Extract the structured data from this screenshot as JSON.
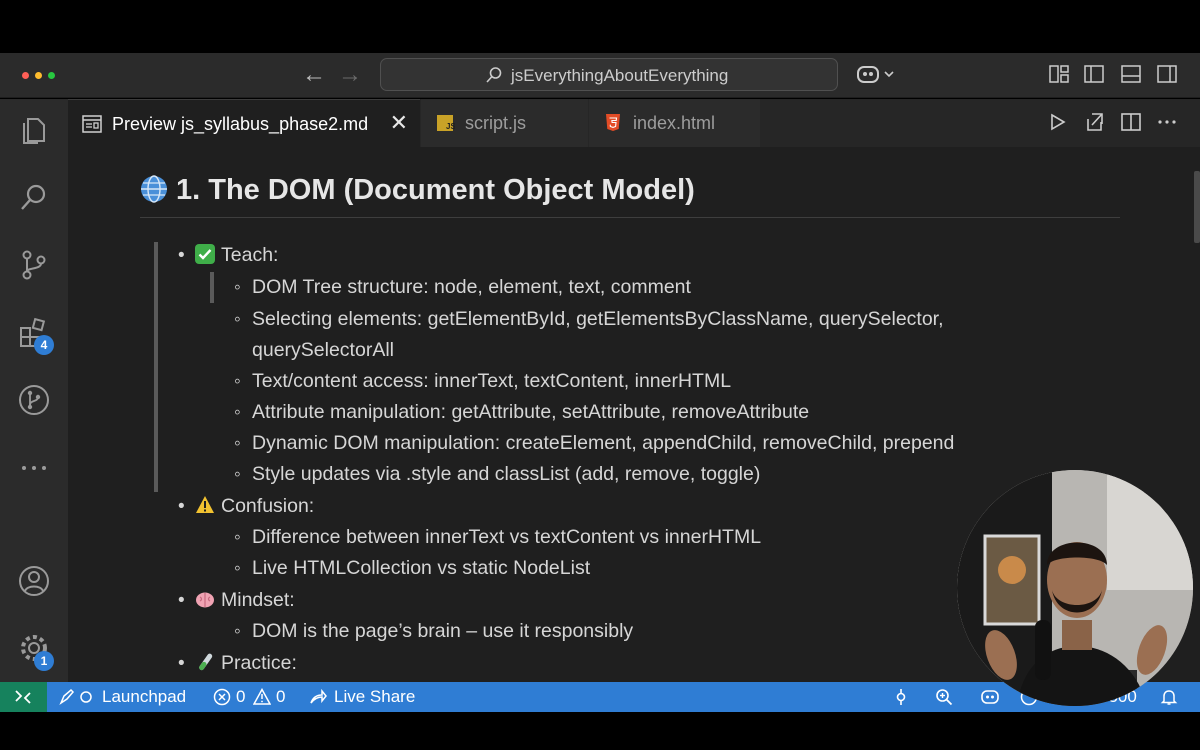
{
  "window": {
    "command_center": "jsEverythingAboutEverything",
    "traffic_colors": [
      "#ff5f57",
      "#febc2e",
      "#28c840"
    ]
  },
  "tabs": [
    {
      "label": "Preview js_syllabus_phase2.md",
      "active": true,
      "icon": "preview-icon",
      "close": "✕"
    },
    {
      "label": "script.js",
      "active": false,
      "icon": "js-file-icon"
    },
    {
      "label": "index.html",
      "active": false,
      "icon": "html5-file-icon"
    }
  ],
  "activity_bar": {
    "extensions_badge": "4",
    "manage_badge": "1"
  },
  "doc": {
    "heading": "1. The DOM (Document Object Model)",
    "sections": [
      {
        "emoji": "check-mark-emoji",
        "label": "Teach:",
        "items": [
          "DOM Tree structure: node, element, text, comment",
          "Selecting elements: getElementById, getElementsByClassName, querySelector,",
          "querySelectorAll",
          "Text/content access: innerText, textContent, innerHTML",
          "Attribute manipulation: getAttribute, setAttribute, removeAttribute",
          "Dynamic DOM manipulation: createElement, appendChild, removeChild, prepend",
          "Style updates via .style and classList (add, remove, toggle)"
        ]
      },
      {
        "emoji": "warning-emoji",
        "label": "Confusion:",
        "items": [
          "Difference between innerText vs textContent vs innerHTML",
          "Live HTMLCollection vs static NodeList"
        ]
      },
      {
        "emoji": "brain-emoji",
        "label": "Mindset:",
        "items": [
          "DOM is the page’s brain – use it responsibly"
        ]
      },
      {
        "emoji": "test-tube-emoji",
        "label": "Practice:",
        "items": []
      }
    ]
  },
  "status_bar": {
    "launchpad": "Launchpad",
    "errors": "0",
    "warnings": "0",
    "live_share": "Live Share",
    "port_partial": "5500",
    "colors": {
      "bar": "#2f7dd4",
      "remote": "#16825d"
    }
  }
}
